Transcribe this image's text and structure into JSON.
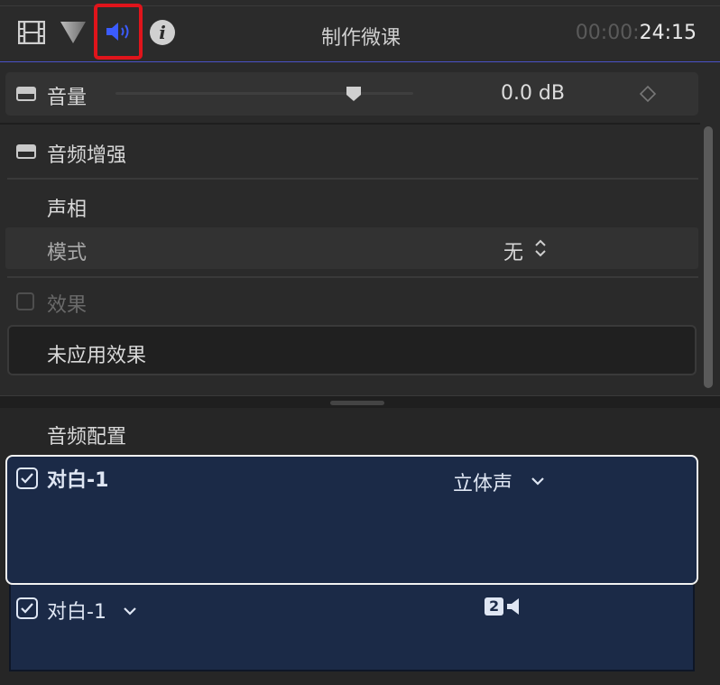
{
  "header": {
    "clip_title": "制作微课",
    "timecode_dim": "00:00:",
    "timecode_lit": "24:15",
    "icons": [
      "film-icon",
      "filter-icon",
      "audio-speaker-icon",
      "info-icon"
    ],
    "info_glyph": "i"
  },
  "volume": {
    "label": "音量",
    "value": "0.0 dB",
    "level": 0.8
  },
  "audio_enhancements": {
    "title": "音频增强"
  },
  "pan": {
    "title": "声相",
    "mode_label": "模式",
    "mode_value": "无"
  },
  "effects": {
    "title": "效果",
    "empty_text": "未应用效果"
  },
  "audio_configuration": {
    "title": "音频配置",
    "role": {
      "name": "对白-1",
      "channel_mode": "立体声",
      "checked": true
    },
    "sub_role": {
      "name": "对白-1",
      "channel_count": "2",
      "checked": true
    }
  },
  "colors": {
    "accent_line": "#4a52c8",
    "highlight_box": "#e0141b",
    "audio_icon": "#3b5cff",
    "role_card_bg": "#1b2a47"
  }
}
